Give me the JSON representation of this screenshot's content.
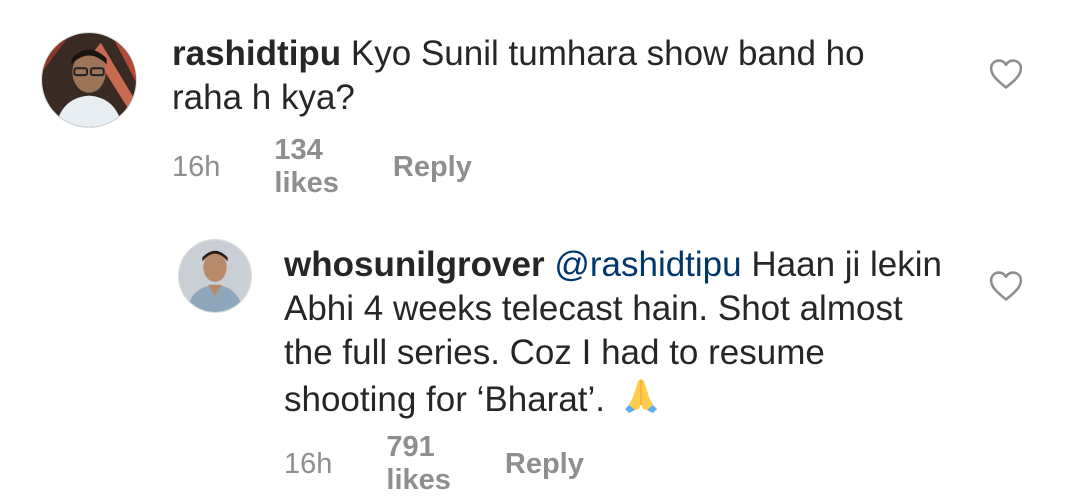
{
  "comments": [
    {
      "username": "rashidtipu",
      "text": "Kyo Sunil tumhara show band ho",
      "text2": "raha h kya?",
      "time": "16h",
      "likes": "134 likes",
      "reply": "Reply"
    },
    {
      "username": "whosunilgrover",
      "mention": "@rashidtipu",
      "line1": "Haan ji lekin",
      "line2": "Abhi 4 weeks telecast hain. Shot almost",
      "line3": "the full series. Coz I had to resume",
      "line4": "shooting for ‘Bharat’.",
      "emoji": "🙏",
      "time": "16h",
      "likes": "791 likes",
      "reply": "Reply"
    }
  ],
  "icons": {
    "heart": "heart-outline-icon",
    "emoji_color": "#ffcc4d"
  }
}
